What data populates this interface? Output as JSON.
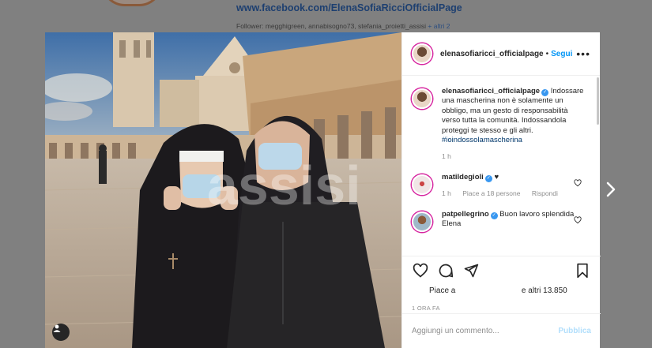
{
  "background": {
    "page_link": "www.facebook.com/ElenaSofiaRicciOfficialPage",
    "followers_label": "Follower: megghigreen, annabisogno73, stefania_proietti_assisi",
    "followers_more": "+ altri 2"
  },
  "photo": {
    "watermark": "assisi",
    "tag_icon": "user-tag-icon"
  },
  "header": {
    "username": "elenasofiaricci_officialpage",
    "separator": "•",
    "follow_label": "Segui",
    "more_icon": "more-options-icon"
  },
  "caption": {
    "username": "elenasofiaricci_officialpage",
    "text": "Indossare una mascherina non è solamente un obbligo, ma un gesto di responsabilità verso tutta la comunità. Indossandola proteggi te stesso e gli altri.",
    "hashtag": "#ioindossolamascherina",
    "time": "1 h"
  },
  "comments": [
    {
      "username": "matildegioli",
      "text": "♥",
      "time": "1 h",
      "likes": "Piace a 18 persone",
      "reply_label": "Rispondi"
    },
    {
      "username": "patpellegrino",
      "text": "Buon lavoro splendida Elena"
    }
  ],
  "actions": {
    "likes_text_start": "Piace a",
    "likes_text_end": "e altri 13.850",
    "timestamp": "1 ORA FA"
  },
  "add_comment": {
    "placeholder": "Aggiungi un commento...",
    "post_label": "Pubblica"
  },
  "colors": {
    "accent": "#0095f6",
    "verified": "#3897f0",
    "story_ring": "#d6249f"
  }
}
